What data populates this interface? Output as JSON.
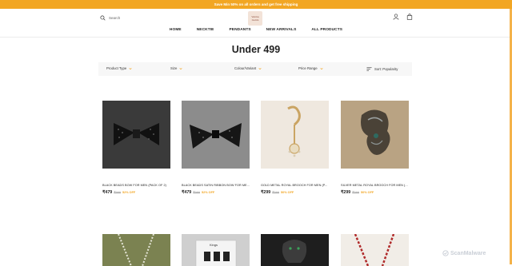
{
  "announcement": "Save Min 50% on all orders and get free shipping",
  "header": {
    "search_placeholder": "Search",
    "logo_text": "Vanna Gents"
  },
  "nav": [
    "HOME",
    "NECKTIE",
    "PENDANTS",
    "NEW ARRIVALS",
    "ALL PRODUCTS"
  ],
  "page_title": "Under 499",
  "filters": {
    "product_type": "Product Type",
    "size": "Size",
    "colour": "Colour/Variant",
    "price_range": "Price Range",
    "sort": "Sort: Popularity"
  },
  "products": [
    {
      "name": "BLACK BEADS BOW FOR MEN (PACK OF 2)",
      "price": "₹479",
      "mrp": "₹999",
      "discount": "52% OFF"
    },
    {
      "name": "BLACK BEADS SATIN RIBBON BOW FOR ME...",
      "price": "₹479",
      "mrp": "₹999",
      "discount": "52% OFF"
    },
    {
      "name": "GOLD METAL ROYAL BROOCH FOR MEN (P...",
      "price": "₹299",
      "mrp": "₹599",
      "discount": "50% OFF"
    },
    {
      "name": "SILVER METAL ROYAL BROOCH FOR MEN (...",
      "price": "₹299",
      "mrp": "₹599",
      "discount": "50% OFF"
    }
  ],
  "second_row_label": "Kings",
  "watermark": "ScanMalware",
  "colors": {
    "accent": "#f2a623",
    "text": "#222222"
  }
}
